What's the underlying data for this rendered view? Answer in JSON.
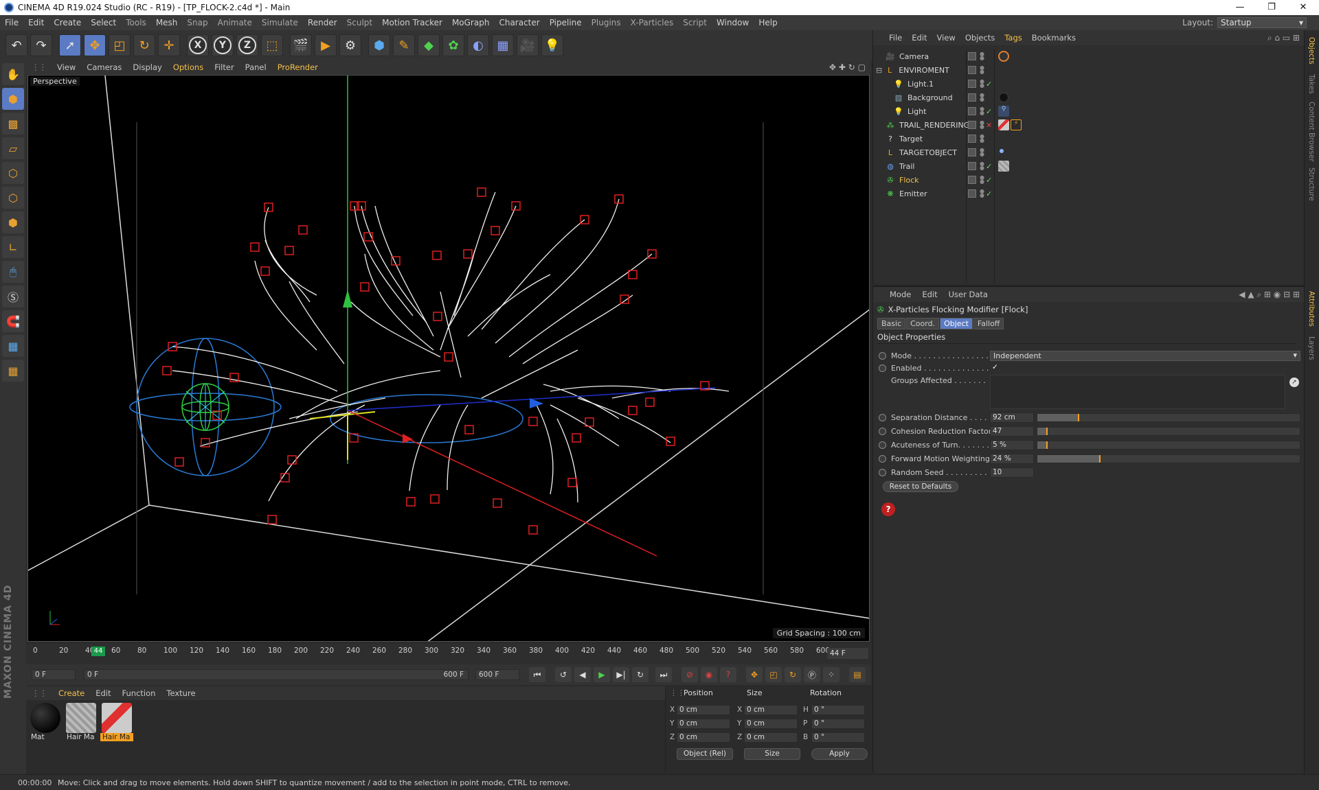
{
  "titlebar": {
    "title": "CINEMA 4D R19.024 Studio (RC - R19) - [TP_FLOCK-2.c4d *] - Main",
    "min": "—",
    "max": "❐",
    "close": "✕"
  },
  "menubar": {
    "items": [
      "File",
      "Edit",
      "Create",
      "Select",
      "Tools",
      "Mesh",
      "Snap",
      "Animate",
      "Simulate",
      "Render",
      "Sculpt",
      "Motion Tracker",
      "MoGraph",
      "Character",
      "Pipeline",
      "Plugins",
      "X-Particles",
      "Script",
      "Window",
      "Help"
    ],
    "layout_label": "Layout:",
    "layout_value": "Startup"
  },
  "viewport": {
    "menu": [
      "View",
      "Cameras",
      "Display",
      "Options",
      "Filter",
      "Panel",
      "ProRender"
    ],
    "label": "Perspective",
    "grid_spacing": "Grid Spacing : 100 cm"
  },
  "timeline": {
    "ticks": [
      "0",
      "20",
      "40",
      "60",
      "80",
      "100",
      "120",
      "140",
      "160",
      "180",
      "200",
      "220",
      "240",
      "260",
      "280",
      "300",
      "320",
      "340",
      "360",
      "380",
      "400",
      "420",
      "440",
      "460",
      "480",
      "500",
      "520",
      "540",
      "560",
      "580",
      "600"
    ],
    "playhead": "44",
    "current_frame": "44 F"
  },
  "transport": {
    "start": "0 F",
    "range_start": "0 F",
    "range_end": "600 F",
    "end": "600 F"
  },
  "materials": {
    "menu": [
      "Create",
      "Edit",
      "Function",
      "Texture"
    ],
    "items": [
      {
        "name": "Mat"
      },
      {
        "name": "Hair Ma"
      },
      {
        "name": "Hair Ma"
      }
    ]
  },
  "coords": {
    "headers": [
      "Position",
      "Size",
      "Rotation"
    ],
    "rows": [
      {
        "a": "X",
        "pos": "0 cm",
        "b": "X",
        "size": "0 cm",
        "c": "H",
        "rot": "0 °"
      },
      {
        "a": "Y",
        "pos": "0 cm",
        "b": "Y",
        "size": "0 cm",
        "c": "P",
        "rot": "0 °"
      },
      {
        "a": "Z",
        "pos": "0 cm",
        "b": "Z",
        "size": "0 cm",
        "c": "B",
        "rot": "0 °"
      }
    ],
    "mode": "Object (Rel)",
    "size_mode": "Size",
    "apply": "Apply"
  },
  "objects": {
    "menu": [
      "File",
      "Edit",
      "View",
      "Objects",
      "Tags",
      "Bookmarks"
    ],
    "rows": [
      {
        "name": "Camera",
        "icon": "camera-icon"
      },
      {
        "name": "ENVIROMENT",
        "icon": "null-icon"
      },
      {
        "name": "Light.1",
        "icon": "light-icon"
      },
      {
        "name": "Background",
        "icon": "background-icon"
      },
      {
        "name": "Light",
        "icon": "light-icon"
      },
      {
        "name": "TRAIL_RENDERING",
        "icon": "hair-icon"
      },
      {
        "name": "Target",
        "icon": "target-icon"
      },
      {
        "name": "TARGETOBJECT",
        "icon": "null-icon"
      },
      {
        "name": "Trail",
        "icon": "trail-icon"
      },
      {
        "name": "Flock",
        "icon": "flock-icon"
      },
      {
        "name": "Emitter",
        "icon": "emitter-icon"
      }
    ]
  },
  "attributes": {
    "menu": [
      "Mode",
      "Edit",
      "User Data"
    ],
    "title": "X-Particles Flocking Modifier [Flock]",
    "tabs": [
      "Basic",
      "Coord.",
      "Object",
      "Falloff"
    ],
    "section": "Object Properties",
    "mode_label": "Mode . . . . . . . . . . . . . . . .",
    "mode_value": "Independent",
    "enabled_label": "Enabled . . . . . . . . . . . . . .",
    "enabled_value": "✓",
    "groups_label": "Groups Affected . . . . . . .",
    "params": [
      {
        "label": "Separation Distance . . . . . .",
        "value": "92 cm",
        "fraction": 0.16
      },
      {
        "label": "Cohesion Reduction Factor",
        "value": "47",
        "fraction": 0.04
      },
      {
        "label": "Acuteness of Turn. . . . . . . .",
        "value": "5 %",
        "fraction": 0.04
      },
      {
        "label": "Forward Motion Weighting",
        "value": "24 %",
        "fraction": 0.24
      },
      {
        "label": "Random Seed . . . . . . . . . .",
        "value": "10"
      }
    ],
    "reset": "Reset to Defaults"
  },
  "right_tabs": [
    "Objects",
    "Takes",
    "Content Browser",
    "Structure",
    "Attributes",
    "Layers"
  ],
  "status": {
    "time": "00:00:00",
    "message": "Move: Click and drag to move elements. Hold down SHIFT to quantize movement / add to the selection in point mode, CTRL to remove."
  },
  "brand": "MAXON CINEMA 4D",
  "colors": {
    "accent": "#f3c04a",
    "selection": "#5b7bc4",
    "particle": "#e02020",
    "grid": "#ffffff"
  }
}
